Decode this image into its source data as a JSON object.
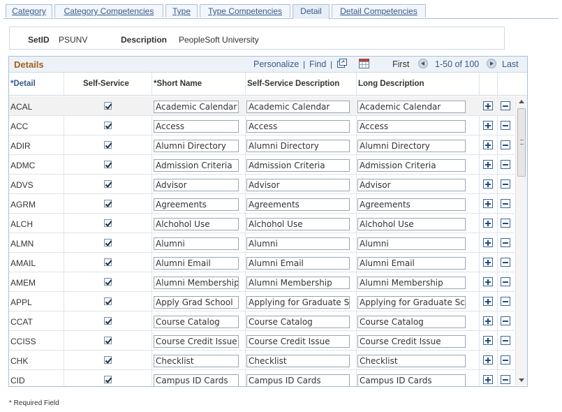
{
  "tabs": [
    {
      "label": "Category",
      "active": false
    },
    {
      "label": "Category Competencies",
      "active": false
    },
    {
      "label": "Type",
      "active": false
    },
    {
      "label": "Type Competencies",
      "active": false
    },
    {
      "label": "Detail",
      "active": true
    },
    {
      "label": "Detail Competencies",
      "active": false
    }
  ],
  "header": {
    "setid_label": "SetID",
    "setid_value": "PSUNV",
    "description_label": "Description",
    "description_value": "PeopleSoft University"
  },
  "grid": {
    "title": "Details",
    "personalize": "Personalize",
    "separator": "|",
    "find": "Find",
    "first": "First",
    "range": "1-50 of 100",
    "last": "Last",
    "icons": [
      "view-all-icon",
      "download-spreadsheet-icon"
    ],
    "columns": {
      "detail": "*Detail",
      "self_service": "Self-Service",
      "short_name": "*Short Name",
      "ss_description": "Self-Service Description",
      "long_description": "Long Description"
    },
    "rows": [
      {
        "code": "ACAL",
        "checked": true,
        "short": "Academic Calendar",
        "ss": "Academic Calendar",
        "long": "Academic Calendar"
      },
      {
        "code": "ACC",
        "checked": true,
        "short": "Access",
        "ss": "Access",
        "long": "Access"
      },
      {
        "code": "ADIR",
        "checked": true,
        "short": "Alumni Directory",
        "ss": "Alumni Directory",
        "long": "Alumni Directory"
      },
      {
        "code": "ADMC",
        "checked": true,
        "short": "Admission Criteria",
        "ss": "Admission Criteria",
        "long": "Admission Criteria"
      },
      {
        "code": "ADVS",
        "checked": true,
        "short": "Advisor",
        "ss": "Advisor",
        "long": "Advisor"
      },
      {
        "code": "AGRM",
        "checked": true,
        "short": "Agreements",
        "ss": "Agreements",
        "long": "Agreements"
      },
      {
        "code": "ALCH",
        "checked": true,
        "short": "Alchohol Use",
        "ss": "Alchohol Use",
        "long": "Alchohol Use"
      },
      {
        "code": "ALMN",
        "checked": true,
        "short": "Alumni",
        "ss": "Alumni",
        "long": "Alumni"
      },
      {
        "code": "AMAIL",
        "checked": true,
        "short": "Alumni Email",
        "ss": "Alumni Email",
        "long": "Alumni Email"
      },
      {
        "code": "AMEM",
        "checked": true,
        "short": "Alumni Membership",
        "ss": "Alumni Membership",
        "long": "Alumni Membership"
      },
      {
        "code": "APPL",
        "checked": true,
        "short": "Apply Grad School",
        "ss": "Applying for Graduate Sc",
        "long": "Applying for Graduate Sch"
      },
      {
        "code": "CCAT",
        "checked": true,
        "short": "Course Catalog",
        "ss": "Course Catalog",
        "long": "Course Catalog"
      },
      {
        "code": "CCISS",
        "checked": true,
        "short": "Course Credit Issue",
        "ss": "Course Credit Issue",
        "long": "Course Credit Issue"
      },
      {
        "code": "CHK",
        "checked": true,
        "short": "Checklist",
        "ss": "Checklist",
        "long": "Checklist"
      },
      {
        "code": "CID",
        "checked": true,
        "short": "Campus ID Cards",
        "ss": "Campus ID Cards",
        "long": "Campus ID Cards"
      }
    ]
  },
  "footer": {
    "required_note": "* Required Field"
  }
}
